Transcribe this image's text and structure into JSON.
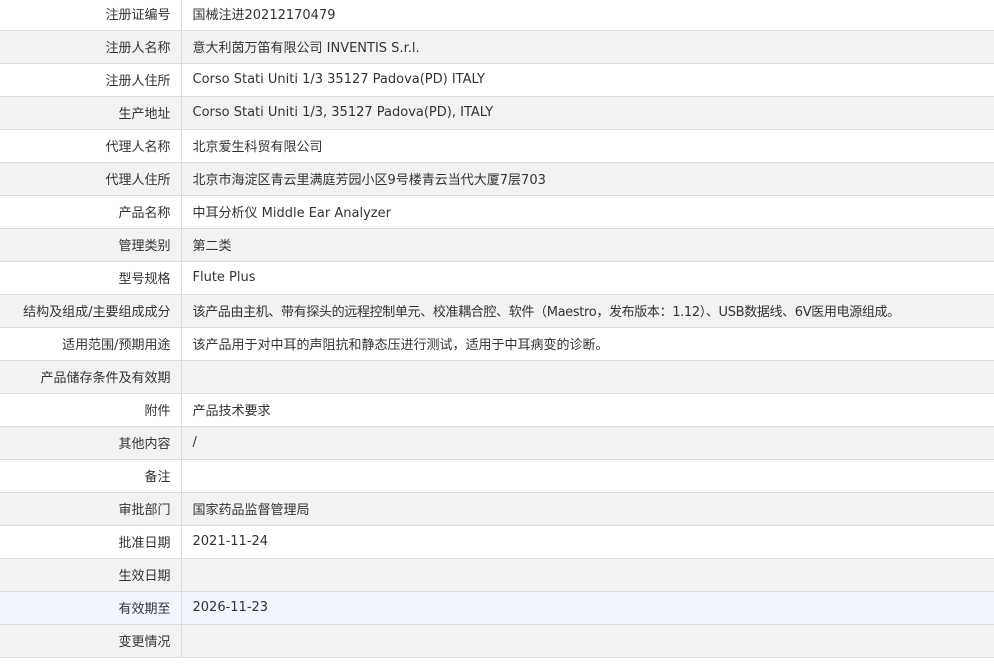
{
  "rows": [
    {
      "label": "注册证编号",
      "value": "国械注进20212170479"
    },
    {
      "label": "注册人名称",
      "value": "意大利茵万笛有限公司 INVENTIS S.r.l."
    },
    {
      "label": "注册人住所",
      "value": "Corso Stati Uniti 1/3 35127 Padova(PD) ITALY"
    },
    {
      "label": "生产地址",
      "value": "Corso Stati Uniti 1/3, 35127 Padova(PD), ITALY"
    },
    {
      "label": "代理人名称",
      "value": "北京爱生科贸有限公司"
    },
    {
      "label": "代理人住所",
      "value": "北京市海淀区青云里满庭芳园小区9号楼青云当代大厦7层703"
    },
    {
      "label": "产品名称",
      "value": "中耳分析仪 Middle Ear Analyzer"
    },
    {
      "label": "管理类别",
      "value": "第二类"
    },
    {
      "label": "型号规格",
      "value": "Flute Plus"
    },
    {
      "label": "结构及组成/主要组成成分",
      "value": "该产品由主机、带有探头的远程控制单元、校准耦合腔、软件（Maestro，发布版本：1.12）、USB数据线、6V医用电源组成。"
    },
    {
      "label": "适用范围/预期用途",
      "value": "该产品用于对中耳的声阻抗和静态压进行测试，适用于中耳病变的诊断。"
    },
    {
      "label": "产品储存条件及有效期",
      "value": ""
    },
    {
      "label": "附件",
      "value": "产品技术要求"
    },
    {
      "label": "其他内容",
      "value": "/"
    },
    {
      "label": "备注",
      "value": ""
    },
    {
      "label": "审批部门",
      "value": "国家药品监督管理局"
    },
    {
      "label": "批准日期",
      "value": "2021-11-24"
    },
    {
      "label": "生效日期",
      "value": ""
    },
    {
      "label": "有效期至",
      "value": "2026-11-23"
    },
    {
      "label": "变更情况",
      "value": ""
    }
  ]
}
